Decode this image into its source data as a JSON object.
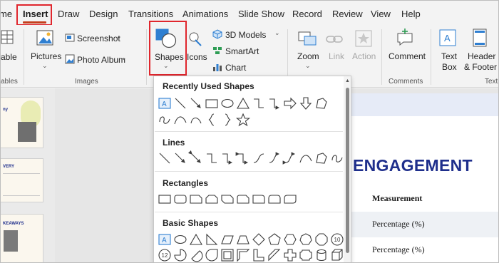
{
  "tabs": [
    {
      "label": "me"
    },
    {
      "label": "Insert"
    },
    {
      "label": "Draw"
    },
    {
      "label": "Design"
    },
    {
      "label": "Transitions"
    },
    {
      "label": "Animations"
    },
    {
      "label": "Slide Show"
    },
    {
      "label": "Record"
    },
    {
      "label": "Review"
    },
    {
      "label": "View"
    },
    {
      "label": "Help"
    }
  ],
  "active_tab": "Insert",
  "highlight_color": "#e0262d",
  "ribbon": {
    "table_label": "able",
    "tables_group": "ables",
    "pictures_label": "Pictures",
    "screenshot_label": "Screenshot",
    "photo_album_label": "Photo Album",
    "images_group": "Images",
    "shapes_label": "Shapes",
    "icons_label": "Icons",
    "models_label": "3D Models",
    "smartart_label": "SmartArt",
    "chart_label": "Chart",
    "zoom_label": "Zoom",
    "link_label": "Link",
    "action_label": "Action",
    "comment_label": "Comment",
    "comments_group": "Comments",
    "textbox_label_1": "Text",
    "textbox_label_2": "Box",
    "header_label_1": "Header",
    "header_label_2": "& Footer",
    "text_group": "Text"
  },
  "gallery": {
    "sections": [
      {
        "title": "Recently Used Shapes"
      },
      {
        "title": "Lines"
      },
      {
        "title": "Rectangles"
      },
      {
        "title": "Basic Shapes"
      }
    ],
    "recent_row1": [
      "text-box-shape",
      "line-shape",
      "arrow-line-shape",
      "rectangle-shape",
      "oval-shape",
      "triangle-shape",
      "elbow-connector-shape",
      "elbow-arrow-connector-shape",
      "right-arrow-shape",
      "down-arrow-shape",
      "freeform-shape"
    ],
    "recent_row2": [
      "scribble-shape",
      "curve-shape",
      "arc-shape",
      "left-brace-shape",
      "right-brace-shape",
      "star-shape"
    ],
    "lines_row": [
      "line-shape",
      "arrow-line-shape",
      "double-arrow-line-shape",
      "elbow-connector-shape",
      "elbow-arrow-connector-shape",
      "elbow-double-arrow-shape",
      "curved-connector-shape",
      "curved-arrow-connector-shape",
      "curved-double-arrow-shape",
      "curve-shape",
      "freeform-shape",
      "scribble-shape"
    ],
    "rect_row": [
      "rectangle-shape",
      "rounded-rectangle-shape",
      "snip-single-corner-shape",
      "snip-same-side-shape",
      "snip-diagonal-shape",
      "snip-round-corner-shape",
      "round-single-corner-shape",
      "round-same-side-shape",
      "round-diagonal-shape"
    ],
    "basic_row1": [
      "text-box-shape",
      "oval-shape",
      "isosceles-triangle-shape",
      "right-triangle-shape",
      "parallelogram-shape",
      "trapezoid-shape",
      "diamond-shape",
      "pentagon-shape",
      "hexagon-shape",
      "heptagon-shape",
      "octagon-shape",
      "decagon-shape"
    ],
    "basic_row2": [
      "dodecagon-shape",
      "pie-shape",
      "chord-shape",
      "teardrop-shape",
      "frame-shape",
      "half-frame-shape",
      "l-shape",
      "diagonal-stripe-shape",
      "cross-shape",
      "plaque-shape",
      "can-shape",
      "cube-shape"
    ],
    "decagon_label": "10",
    "dodecagon_label": "12"
  },
  "slide": {
    "title": "ENGAGEMENT",
    "rows": [
      {
        "text": "Measurement"
      },
      {
        "text": "Percentage (%)"
      },
      {
        "text": "Percentage (%)"
      }
    ],
    "title_color": "#1f2f8c"
  },
  "left_pane": {
    "thumb1_text": "ny",
    "thumb2_text": "VERY",
    "thumb3_text": "KEAWAYS"
  }
}
